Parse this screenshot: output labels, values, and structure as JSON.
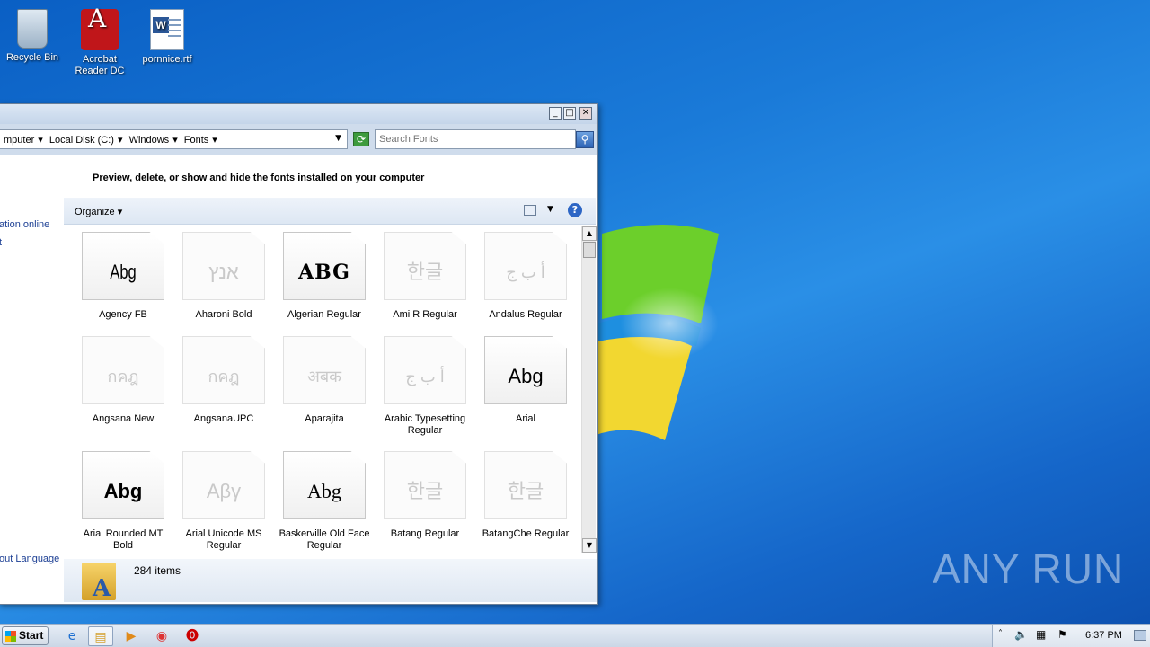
{
  "desktop": {
    "icons": [
      {
        "label": "Recycle Bin"
      },
      {
        "label": "Acrobat Reader DC"
      },
      {
        "label": "pornnice.rtf"
      }
    ],
    "watermark": "ANY RUN"
  },
  "window": {
    "breadcrumbs": [
      "mputer",
      "Local Disk (C:)",
      "Windows",
      "Fonts"
    ],
    "search_placeholder": "Search Fonts",
    "heading": "Preview, delete, or show and hide the fonts installed on your computer",
    "left_links": [
      "ation online",
      "t",
      "out Language"
    ],
    "toolbar": {
      "organize_label": "Organize"
    },
    "fonts": [
      {
        "name": "Agency FB",
        "sample": "Abg",
        "family": true,
        "faded": false
      },
      {
        "name": "Aharoni Bold",
        "sample": "אנץ",
        "family": false,
        "faded": true
      },
      {
        "name": "Algerian Regular",
        "sample": "ABG",
        "family": false,
        "faded": false
      },
      {
        "name": "Ami R Regular",
        "sample": "한글",
        "family": false,
        "faded": true
      },
      {
        "name": "Andalus Regular",
        "sample": "أ ب ج",
        "family": false,
        "faded": true
      },
      {
        "name": "Angsana New",
        "sample": "กคฎ",
        "family": true,
        "faded": true
      },
      {
        "name": "AngsanaUPC",
        "sample": "กคฎ",
        "family": true,
        "faded": true
      },
      {
        "name": "Aparajita",
        "sample": "अबक",
        "family": true,
        "faded": true
      },
      {
        "name": "Arabic Typesetting Regular",
        "sample": "أ ب ج",
        "family": false,
        "faded": true
      },
      {
        "name": "Arial",
        "sample": "Abg",
        "family": true,
        "faded": false
      },
      {
        "name": "Arial Rounded MT Bold",
        "sample": "Abg",
        "family": false,
        "faded": false
      },
      {
        "name": "Arial Unicode MS Regular",
        "sample": "Αβγ",
        "family": false,
        "faded": true
      },
      {
        "name": "Baskerville Old Face Regular",
        "sample": "Abg",
        "family": false,
        "faded": false
      },
      {
        "name": "Batang Regular",
        "sample": "한글",
        "family": false,
        "faded": true
      },
      {
        "name": "BatangChe Regular",
        "sample": "한글",
        "family": false,
        "faded": true
      }
    ],
    "status": {
      "item_count": "284 items"
    }
  },
  "taskbar": {
    "start_label": "Start",
    "clock": "6:37 PM"
  }
}
